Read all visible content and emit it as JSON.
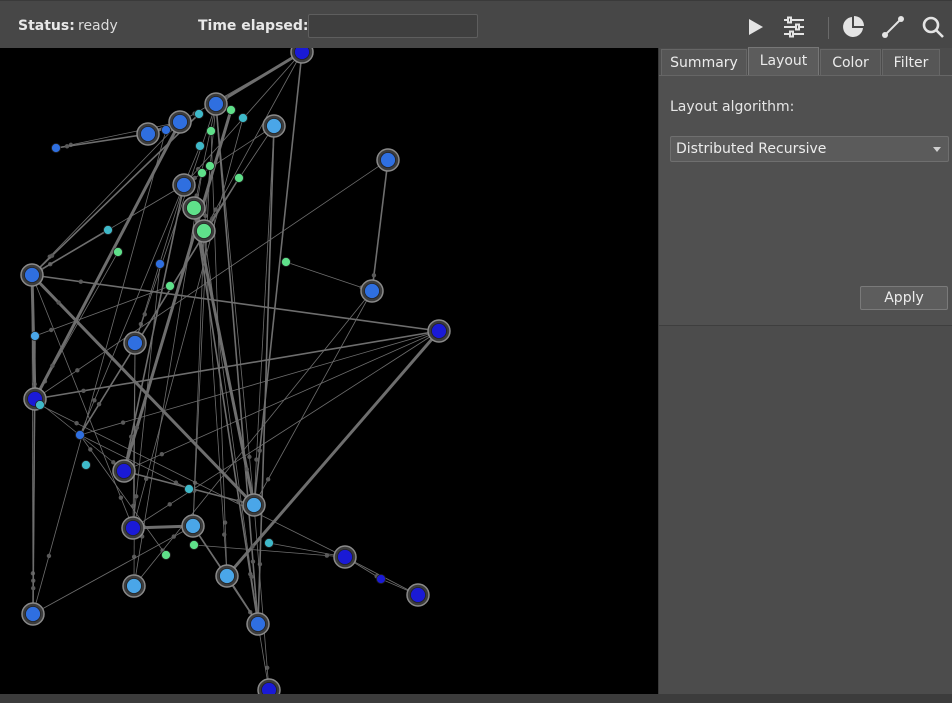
{
  "status": {
    "label": "Status:",
    "value": "ready"
  },
  "time": {
    "label": "Time elapsed:",
    "value": ""
  },
  "toolbar": {
    "icons": [
      "play-icon",
      "sliders-icon",
      "pie-chart-icon",
      "edge-icon",
      "search-icon"
    ]
  },
  "panel": {
    "tabs": [
      {
        "label": "Summary",
        "active": false
      },
      {
        "label": "Layout",
        "active": true
      },
      {
        "label": "Color",
        "active": false
      },
      {
        "label": "Filter",
        "active": false
      }
    ],
    "layout": {
      "algorithm_label": "Layout algorithm:",
      "algorithm_value": "Distributed Recursive",
      "apply_label": "Apply"
    }
  },
  "colors": {
    "background": "#000000",
    "edge": "#6e6e6e",
    "node_dark_blue": "#1a1ad6",
    "node_blue": "#2f6fe0",
    "node_light_blue": "#4aa6e8",
    "node_teal": "#3fb9c9",
    "node_green": "#5fe08a"
  }
}
